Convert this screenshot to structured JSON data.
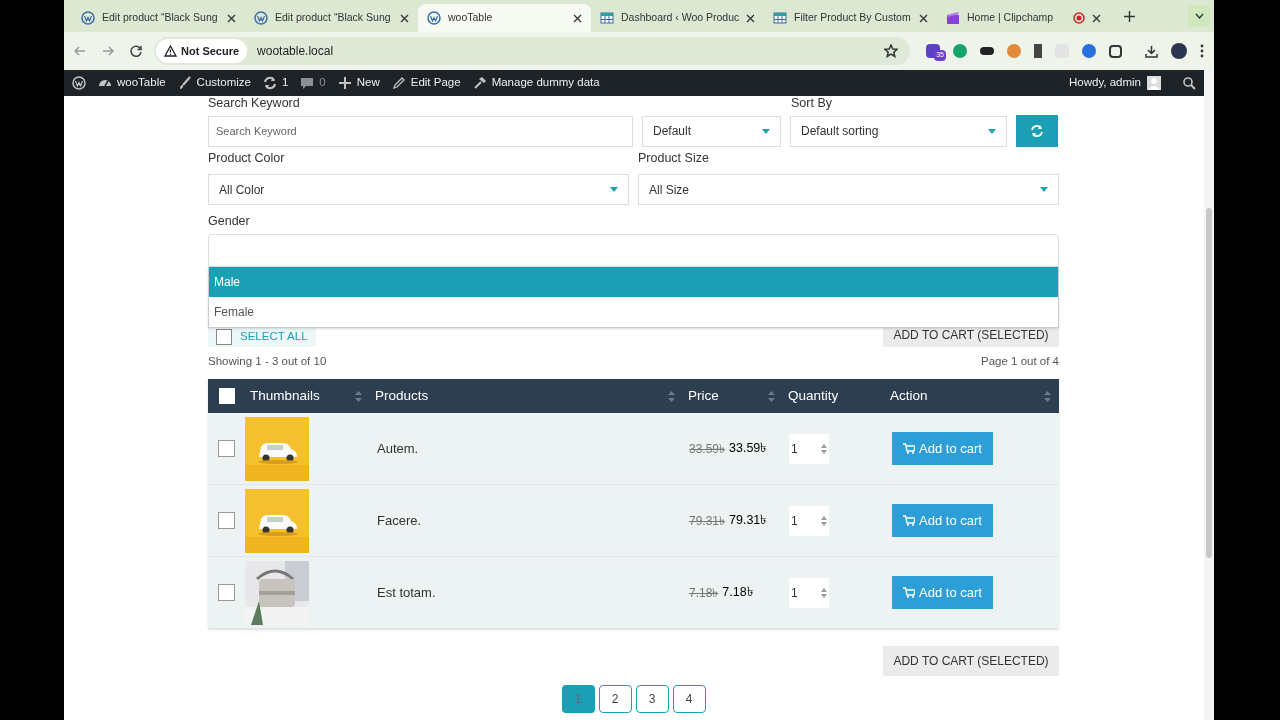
{
  "browser": {
    "tabs": [
      {
        "title": "Edit product “Black Sung",
        "kind": "wordpress",
        "selected": false,
        "recording": false
      },
      {
        "title": "Edit product “Black Sung",
        "kind": "wordpress",
        "selected": false,
        "recording": false
      },
      {
        "title": "wooTable",
        "kind": "wordpress",
        "selected": true,
        "recording": false
      },
      {
        "title": "Dashboard ‹ Woo Produc",
        "kind": "table",
        "selected": false,
        "recording": false
      },
      {
        "title": "Filter Product By Custom",
        "kind": "table",
        "selected": false,
        "recording": false
      },
      {
        "title": "Home | Clipchamp",
        "kind": "clapper",
        "selected": false,
        "recording": true
      }
    ],
    "security": "Not Secure",
    "url": "wootable.local",
    "extension_badge": "35"
  },
  "admin_bar": {
    "items": [
      {
        "kind": "logo"
      },
      {
        "kind": "site",
        "label": "wooTable"
      },
      {
        "kind": "customize",
        "label": "Customize"
      },
      {
        "kind": "updates",
        "label": "1"
      },
      {
        "kind": "comments",
        "label": "0"
      },
      {
        "kind": "new",
        "label": "New"
      },
      {
        "kind": "edit",
        "label": "Edit Page"
      },
      {
        "kind": "tool",
        "label": "Manage dummy data"
      }
    ],
    "greeting": "Howdy, admin"
  },
  "filters": {
    "search_label": "Search Keyword",
    "search_placeholder": "Search Keyword",
    "order_value": "Default",
    "sort_label": "Sort By",
    "sort_value": "Default sorting",
    "color_label": "Product Color",
    "color_value": "All Color",
    "size_label": "Product Size",
    "size_value": "All Size",
    "gender_label": "Gender",
    "gender_options": [
      {
        "label": "Male",
        "selected": true
      },
      {
        "label": "Female",
        "selected": false
      }
    ]
  },
  "select_all": "SELECT ALL",
  "select_all_checked": false,
  "add_selected_top": "ADD TO CART (SELECTED)",
  "showing": "Showing 1 - 3 out of 10",
  "page_info": "Page 1 out of 4",
  "table": {
    "all_checked": false,
    "columns": [
      {
        "label": "Thumbnails",
        "sortable": true
      },
      {
        "label": "Products",
        "sortable": true
      },
      {
        "label": "Price",
        "sortable": true
      },
      {
        "label": "Quantity",
        "sortable": false
      },
      {
        "label": "Action",
        "sortable": true
      }
    ],
    "rows": [
      {
        "checked": false,
        "product": "Autem.",
        "old_price": "33.59৳",
        "price": "33.59৳",
        "quantity": "1",
        "action": "Add to cart"
      },
      {
        "checked": false,
        "product": "Facere.",
        "old_price": "79.31৳",
        "price": "79.31৳",
        "quantity": "1",
        "action": "Add to cart"
      },
      {
        "checked": false,
        "product": "Est totam.",
        "old_price": "7.18৳",
        "price": "7.18৳",
        "quantity": "1",
        "action": "Add to cart"
      }
    ]
  },
  "add_selected_bottom": "ADD TO CART (SELECTED)",
  "pagination": [
    {
      "label": "1",
      "selected": true
    },
    {
      "label": "2",
      "selected": false
    },
    {
      "label": "3",
      "selected": false
    },
    {
      "label": "4",
      "selected": false
    }
  ]
}
